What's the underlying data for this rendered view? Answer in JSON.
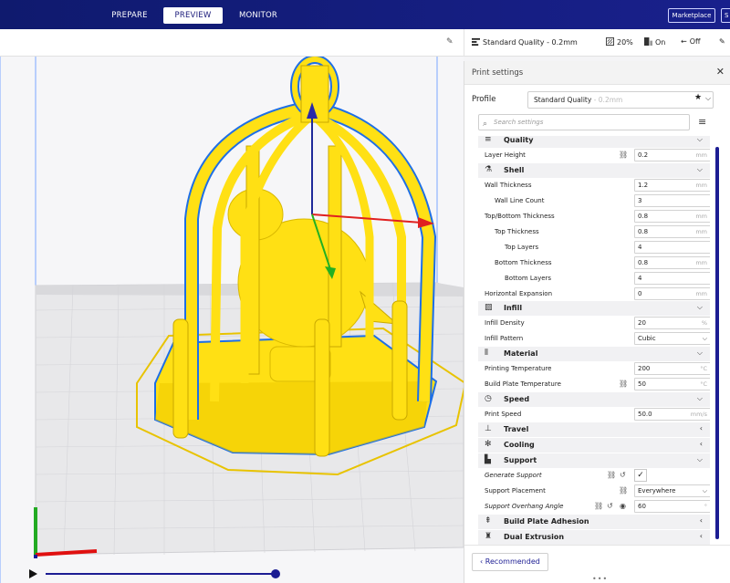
{
  "topbar": {
    "tabs": [
      {
        "label": "PREPARE"
      },
      {
        "label": "PREVIEW"
      },
      {
        "label": "MONITOR"
      }
    ],
    "marketplace_label": "Marketplace",
    "signin_label": "S"
  },
  "summary": {
    "profile": "Standard Quality - 0.2mm",
    "infill": "20%",
    "support": "On",
    "adhesion": "Off"
  },
  "panel": {
    "title": "Print settings",
    "profile_label": "Profile",
    "profile_name": "Standard Quality",
    "profile_sub": " - 0.2mm",
    "search_placeholder": "Search settings",
    "recommended_label": "Recommended",
    "categories": {
      "quality": "Quality",
      "shell": "Shell",
      "infill": "Infill",
      "material": "Material",
      "speed": "Speed",
      "travel": "Travel",
      "cooling": "Cooling",
      "support": "Support",
      "adhesion": "Build Plate Adhesion",
      "dual": "Dual Extrusion"
    },
    "settings": {
      "layer_height": {
        "label": "Layer Height",
        "value": "0.2",
        "unit": "mm"
      },
      "wall_thickness": {
        "label": "Wall Thickness",
        "value": "1.2",
        "unit": "mm"
      },
      "wall_line_count": {
        "label": "Wall Line Count",
        "value": "3"
      },
      "top_bottom_thickness": {
        "label": "Top/Bottom Thickness",
        "value": "0.8",
        "unit": "mm"
      },
      "top_thickness": {
        "label": "Top Thickness",
        "value": "0.8",
        "unit": "mm"
      },
      "top_layers": {
        "label": "Top Layers",
        "value": "4"
      },
      "bottom_thickness": {
        "label": "Bottom Thickness",
        "value": "0.8",
        "unit": "mm"
      },
      "bottom_layers": {
        "label": "Bottom Layers",
        "value": "4"
      },
      "horizontal_expansion": {
        "label": "Horizontal Expansion",
        "value": "0",
        "unit": "mm"
      },
      "infill_density": {
        "label": "Infill Density",
        "value": "20",
        "unit": "%"
      },
      "infill_pattern": {
        "label": "Infill Pattern",
        "value": "Cubic"
      },
      "printing_temperature": {
        "label": "Printing Temperature",
        "value": "200",
        "unit": "°C"
      },
      "build_plate_temperature": {
        "label": "Build Plate Temperature",
        "value": "50",
        "unit": "°C"
      },
      "print_speed": {
        "label": "Print Speed",
        "value": "50.0",
        "unit": "mm/s"
      },
      "generate_support": {
        "label": "Generate Support",
        "checked": true,
        "check_glyph": "✓"
      },
      "support_placement": {
        "label": "Support Placement",
        "value": "Everywhere"
      },
      "support_overhang_angle": {
        "label": "Support Overhang Angle",
        "value": "60",
        "unit": "°"
      }
    }
  },
  "colors": {
    "brand_bar": "#15177e",
    "accent": "#1c1d93",
    "model_yellow": "#ffe014",
    "model_outline": "#1e6fe6"
  }
}
